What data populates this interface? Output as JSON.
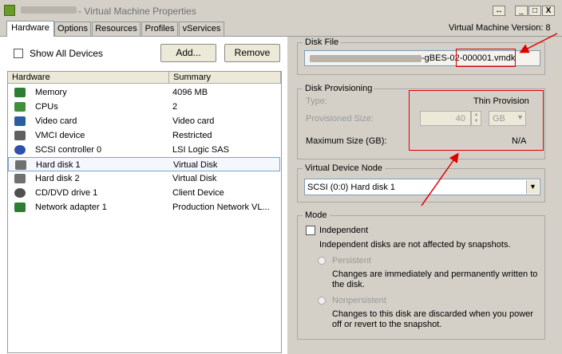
{
  "window": {
    "title": "- Virtual Machine Properties",
    "buttons": {
      "restore": "↔",
      "minimize": "_",
      "maximize": "□",
      "close": "X"
    }
  },
  "tabs": [
    {
      "label": "Hardware",
      "active": true
    },
    {
      "label": "Options",
      "active": false
    },
    {
      "label": "Resources",
      "active": false
    },
    {
      "label": "Profiles",
      "active": false
    },
    {
      "label": "vServices",
      "active": false
    }
  ],
  "vm_version": "Virtual Machine Version: 8",
  "hardware": {
    "show_all_devices": "Show All Devices",
    "add_button": "Add...",
    "remove_button": "Remove",
    "columns": [
      "Hardware",
      "Summary"
    ],
    "rows": [
      {
        "name": "Memory",
        "summary": "4096 MB",
        "icon": "memory-icon",
        "color": "#2e7d32"
      },
      {
        "name": "CPUs",
        "summary": "2",
        "icon": "cpu-icon",
        "color": "#3f8f3a"
      },
      {
        "name": "Video card",
        "summary": "Video card",
        "icon": "monitor-icon",
        "color": "#2c5e9e"
      },
      {
        "name": "VMCI device",
        "summary": "Restricted",
        "icon": "vmci-device-icon",
        "color": "#606060"
      },
      {
        "name": "SCSI controller 0",
        "summary": "LSI Logic SAS",
        "icon": "scsi-controller-icon",
        "color": "#3050b0"
      },
      {
        "name": "Hard disk 1",
        "summary": "Virtual Disk",
        "icon": "hard-disk-icon",
        "color": "#707070",
        "selected": true
      },
      {
        "name": "Hard disk 2",
        "summary": "Virtual Disk",
        "icon": "hard-disk-icon",
        "color": "#707070"
      },
      {
        "name": "CD/DVD drive 1",
        "summary": "Client Device",
        "icon": "cd-dvd-icon",
        "color": "#505050"
      },
      {
        "name": "Network adapter 1",
        "summary": "Production Network VL...",
        "icon": "network-adapter-icon",
        "color": "#2e7d32"
      }
    ]
  },
  "disk_file": {
    "label": "Disk File",
    "value": "-gBES-02-000001.vmdk"
  },
  "disk_provisioning": {
    "label": "Disk Provisioning",
    "type_label": "Type:",
    "type_value": "Thin Provision",
    "provisioned_label": "Provisioned Size:",
    "provisioned_value": "40",
    "unit": "GB",
    "max_label": "Maximum Size (GB):",
    "max_value": "N/A"
  },
  "virtual_device_node": {
    "label": "Virtual Device Node",
    "value": "SCSI (0:0) Hard disk 1"
  },
  "mode": {
    "label": "Mode",
    "independent": "Independent",
    "independent_desc": "Independent disks are not affected by snapshots.",
    "persistent": "Persistent",
    "persistent_desc_1": "Changes are immediately and permanently written to",
    "persistent_desc_2": "the disk.",
    "nonpersistent": "Nonpersistent",
    "nonpersistent_desc_1": "Changes to this disk are discarded when you power",
    "nonpersistent_desc_2": "off or revert to the snapshot."
  },
  "colors": {
    "annotation_red": "#e00000",
    "dialog_bg": "#d4d0c8"
  }
}
